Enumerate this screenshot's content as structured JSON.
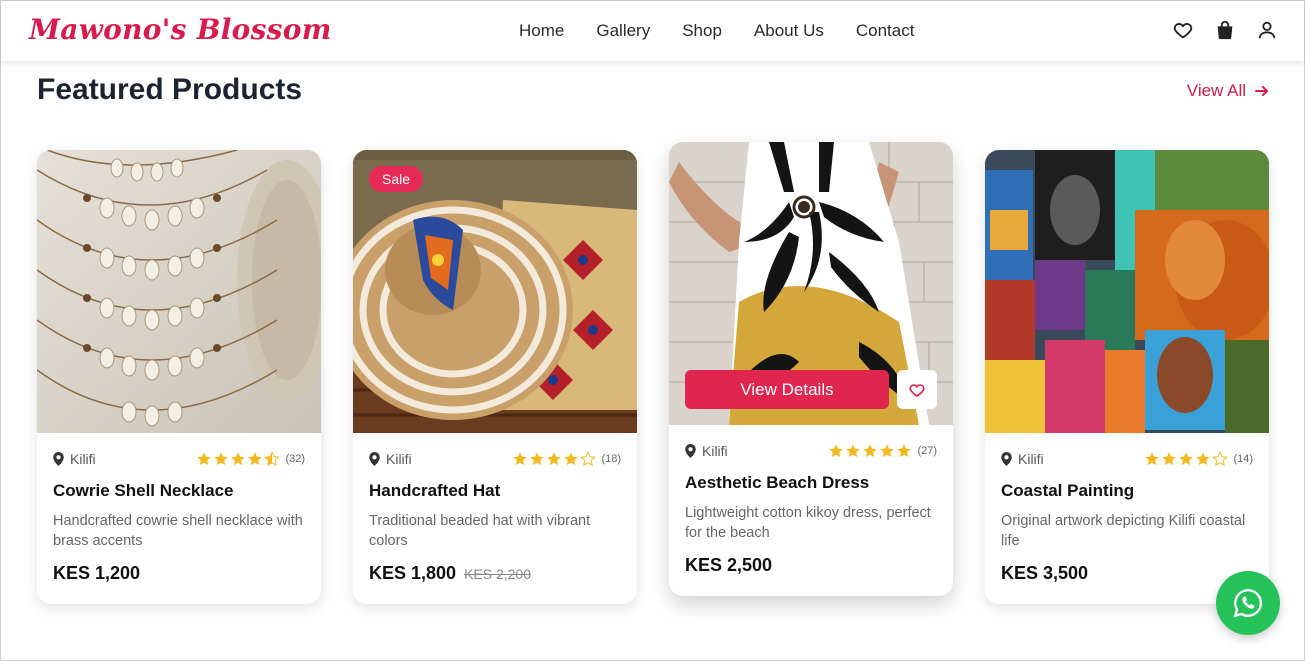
{
  "brand": {
    "name": "Mawono's Blossom",
    "color": "#d81b4a"
  },
  "nav": {
    "items": [
      {
        "label": "Home"
      },
      {
        "label": "Gallery"
      },
      {
        "label": "Shop"
      },
      {
        "label": "About Us"
      },
      {
        "label": "Contact"
      }
    ]
  },
  "header_icons": [
    "heart-icon",
    "shopping-bag-icon",
    "user-icon"
  ],
  "section": {
    "title": "Featured Products",
    "view_all": "View All"
  },
  "products": [
    {
      "location": "Kilifi",
      "rating": 4.5,
      "reviews": "(32)",
      "name": "Cowrie Shell Necklace",
      "description": "Handcrafted cowrie shell necklace with brass accents",
      "price": "KES 1,200",
      "old_price": "",
      "badge": ""
    },
    {
      "location": "Kilifi",
      "rating": 4,
      "reviews": "(18)",
      "name": "Handcrafted Hat",
      "description": "Traditional beaded hat with vibrant colors",
      "price": "KES 1,800",
      "old_price": "KES 2,200",
      "badge": "Sale"
    },
    {
      "location": "Kilifi",
      "rating": 5,
      "reviews": "(27)",
      "name": "Aesthetic Beach Dress",
      "description": "Lightweight cotton kikoy dress, perfect for the beach",
      "price": "KES 2,500",
      "old_price": "",
      "badge": "",
      "hover_action": "View Details"
    },
    {
      "location": "Kilifi",
      "rating": 4,
      "reviews": "(14)",
      "name": "Coastal Painting",
      "description": "Original artwork depicting Kilifi coastal life",
      "price": "KES 3,500",
      "old_price": "",
      "badge": ""
    }
  ],
  "colors": {
    "accent": "#e0264f",
    "star": "#f5b91e",
    "whatsapp": "#25c25a"
  },
  "floating": {
    "icon": "whatsapp-icon"
  }
}
